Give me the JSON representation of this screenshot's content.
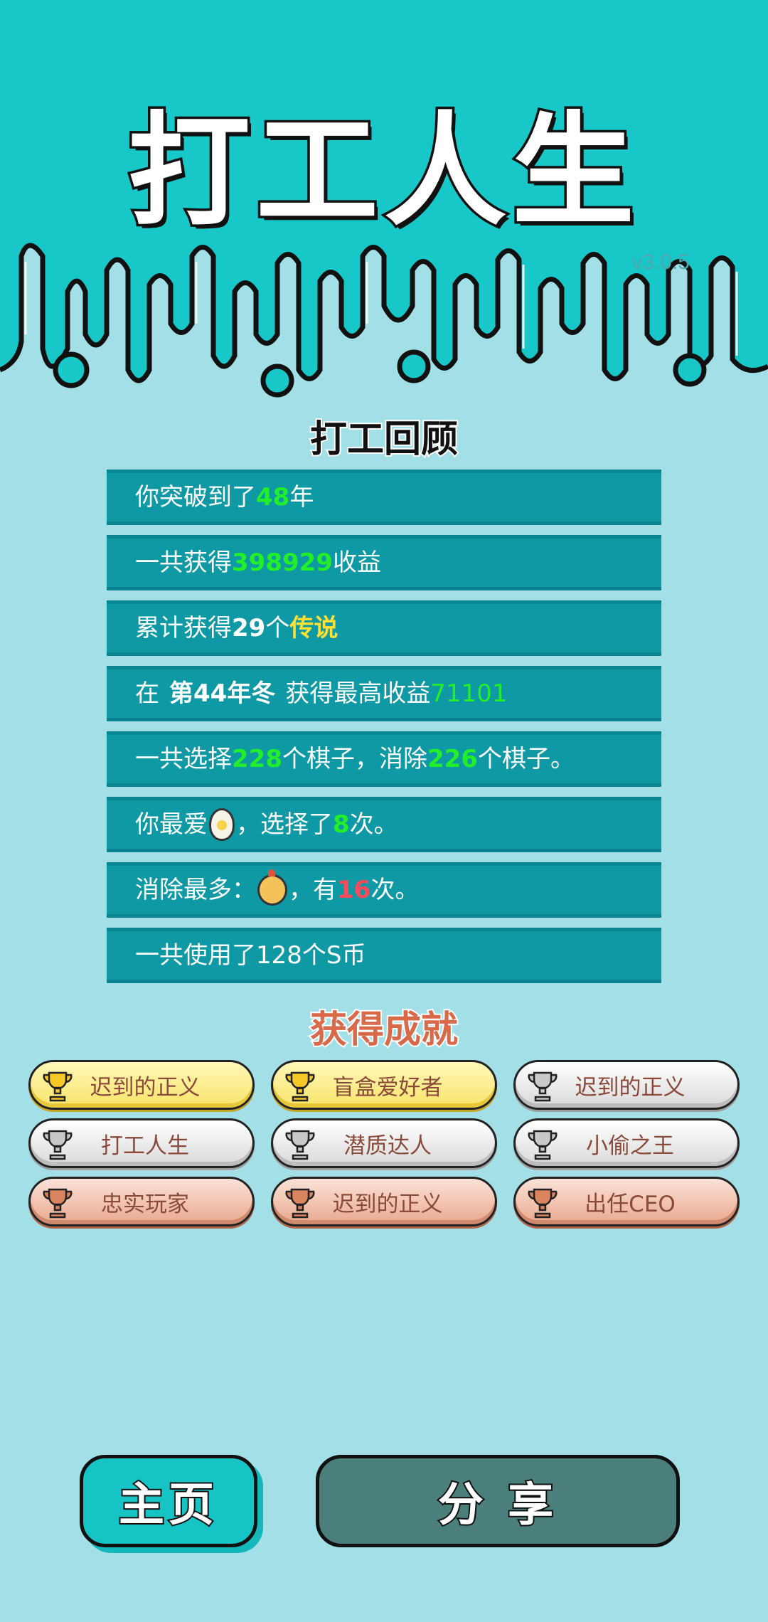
{
  "app": {
    "title": "打工人生",
    "version": "v3.0.5"
  },
  "review": {
    "title": "打工回顾",
    "rows": [
      {
        "pre": "你突破到了",
        "num": "48",
        "post": "年"
      },
      {
        "pre": "一共获得",
        "num": "398929",
        "post": "收益"
      },
      {
        "pre": "累计获得",
        "num": "29",
        "mid": "个",
        "tag": "传说"
      },
      {
        "pre": "在",
        "season": "第44年冬",
        "mid": "获得最高收益",
        "num": "71101"
      },
      {
        "pre": "一共选择",
        "num": "228",
        "mid": "个棋子，消除",
        "num2": "226",
        "post": "个棋子。"
      },
      {
        "pre": "你最爱",
        "icon": "egg-icon",
        "mid": "，选择了",
        "num": "8",
        "post": "次。"
      },
      {
        "pre": "消除最多：",
        "icon": "chick-icon",
        "mid": "，有",
        "num": "16",
        "post": "次。"
      },
      {
        "text": "一共使用了128个S币"
      }
    ]
  },
  "achievements": {
    "title": "获得成就",
    "items": [
      {
        "label": "迟到的正义",
        "tier": "gold"
      },
      {
        "label": "盲盒爱好者",
        "tier": "gold"
      },
      {
        "label": "迟到的正义",
        "tier": "silver"
      },
      {
        "label": "打工人生",
        "tier": "silver"
      },
      {
        "label": "潜质达人",
        "tier": "silver"
      },
      {
        "label": "小偷之王",
        "tier": "silver"
      },
      {
        "label": "忠实玩家",
        "tier": "bronze"
      },
      {
        "label": "迟到的正义",
        "tier": "bronze"
      },
      {
        "label": "出任CEO",
        "tier": "bronze"
      }
    ]
  },
  "buttons": {
    "home": "主页",
    "share": "分 享"
  },
  "colors": {
    "bg": "#a3dfe6",
    "header": "#18c7c8",
    "row": "#0e99a5",
    "highlight": "#22ee2a",
    "legend": "#ffe033",
    "warn": "#ff4a5a"
  }
}
